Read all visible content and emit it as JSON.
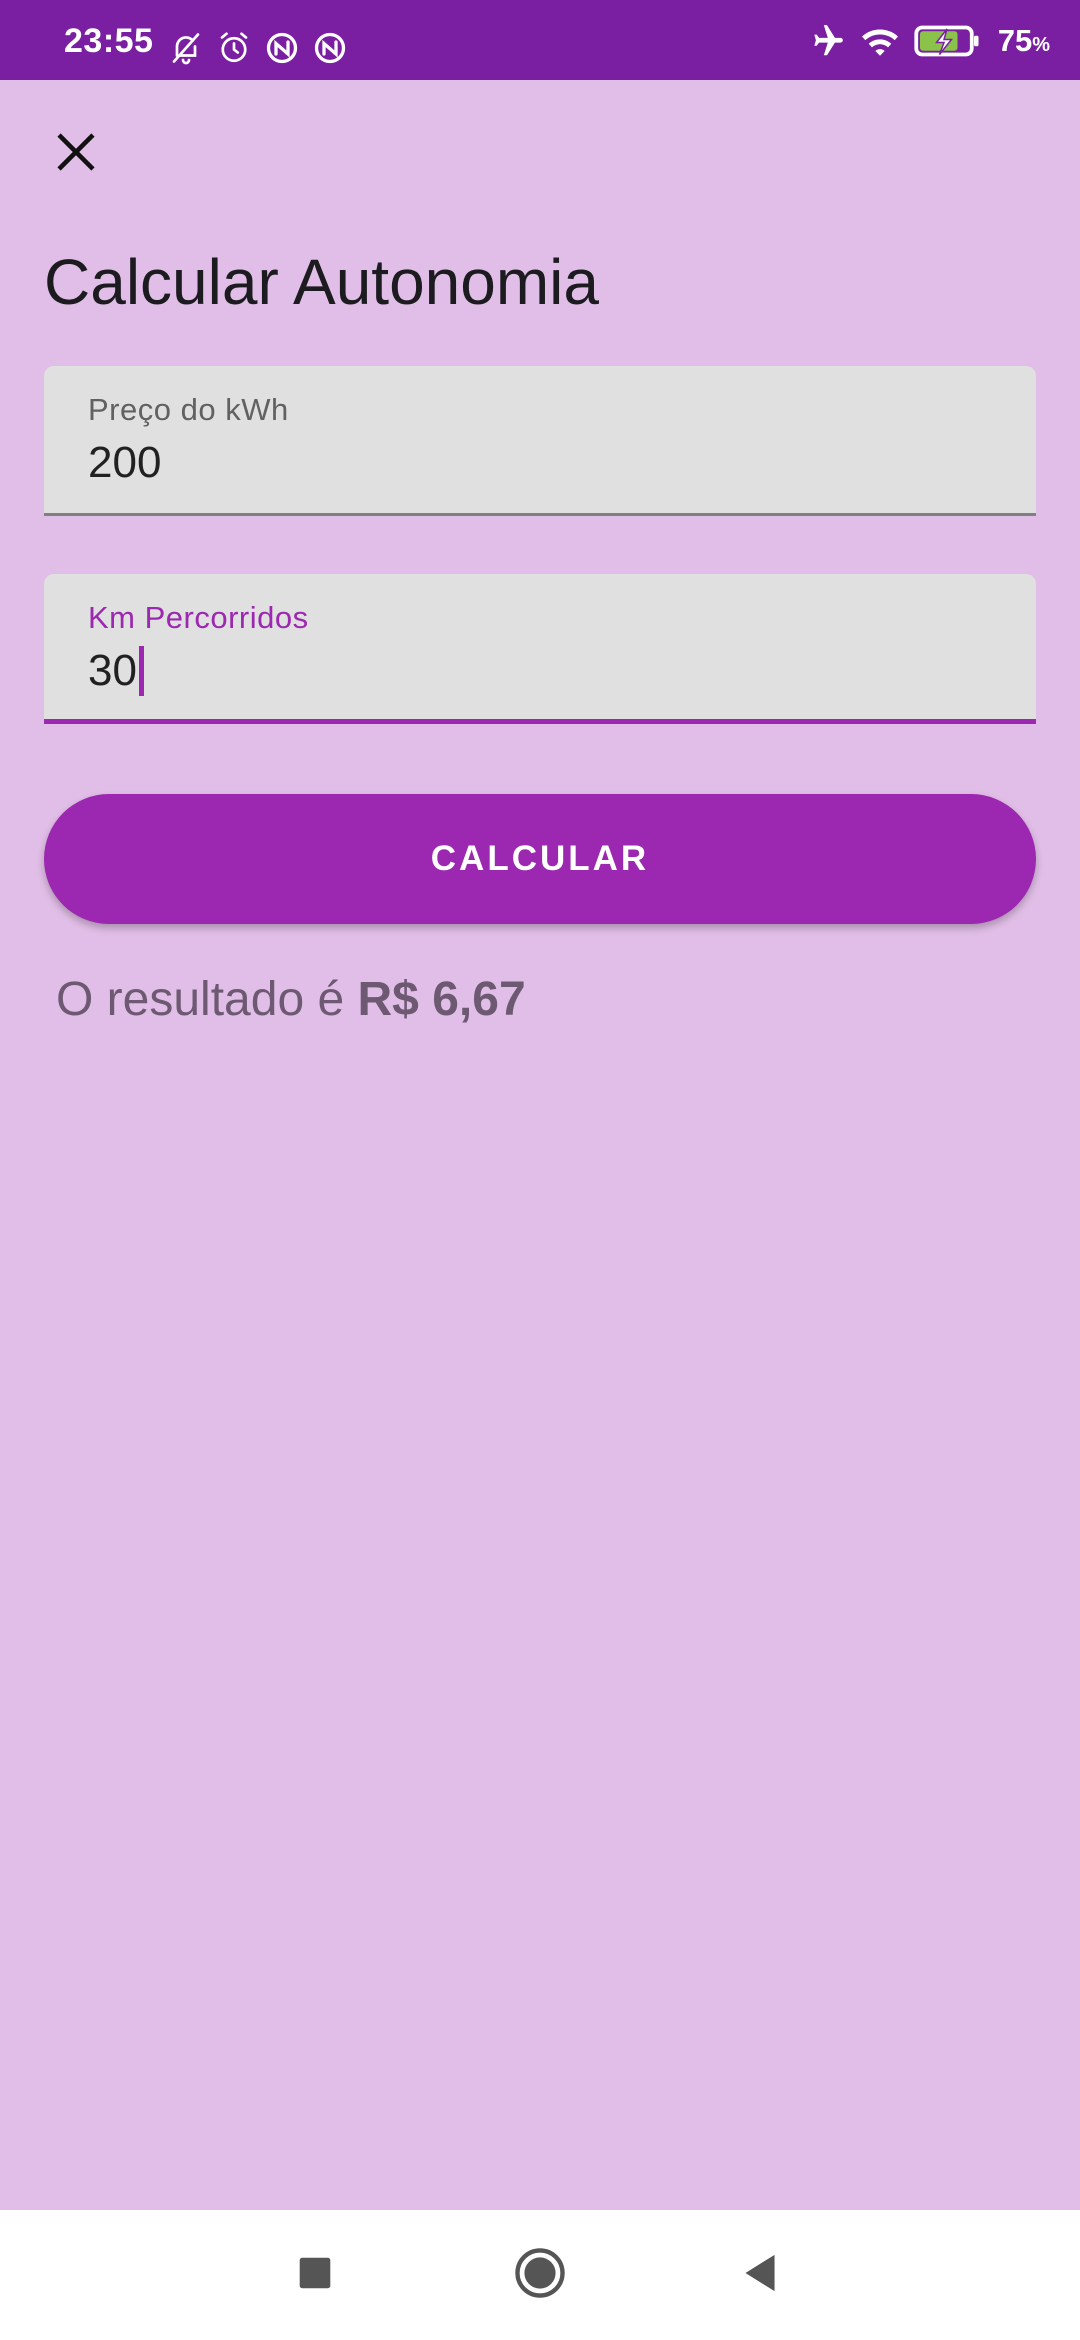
{
  "status_bar": {
    "time": "23:55",
    "left_icons": [
      "bell-off-icon",
      "alarm-icon",
      "no-data-icon",
      "no-data-icon"
    ],
    "right_icons": [
      "airplane-icon",
      "wifi-icon",
      "battery-charging-icon"
    ],
    "battery_percent": "75",
    "battery_unit": "%"
  },
  "header": {
    "close_icon": "close-icon",
    "title": "Calcular Autonomia"
  },
  "form": {
    "price_field": {
      "label": "Preço do kWh",
      "value": "200"
    },
    "km_field": {
      "label": "Km Percorridos",
      "value": "30"
    },
    "calculate_button": "CALCULAR"
  },
  "result": {
    "prefix": "O resultado é",
    "value": "R$ 6,67"
  },
  "nav_bar": {
    "buttons": [
      "recents-icon",
      "home-icon",
      "back-icon"
    ]
  },
  "colors": {
    "status_bar": "#7b1fa2",
    "background": "#e1bee7",
    "accent": "#9c27b0",
    "field_background": "#e0e0e0"
  }
}
